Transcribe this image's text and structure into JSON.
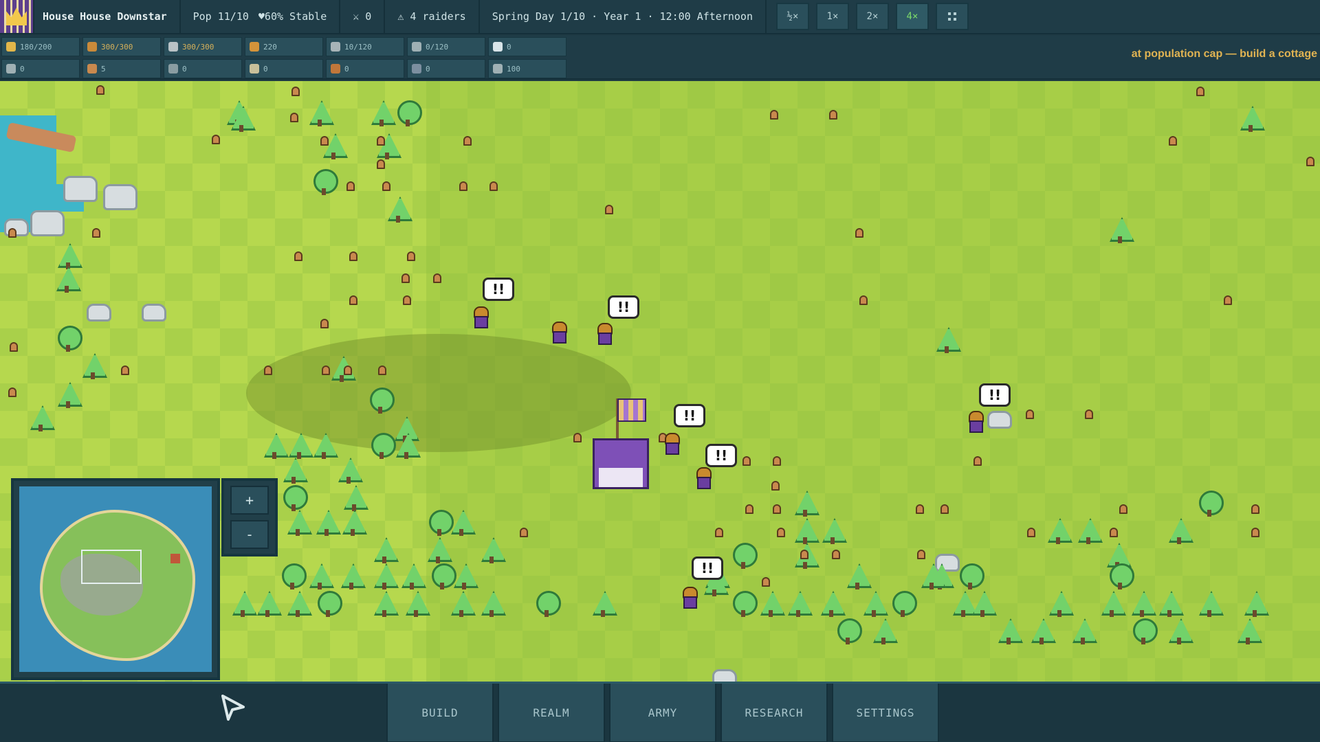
{
  "topbar": {
    "house_name": "House House Downstar",
    "population": "Pop 11/10",
    "stability": "♥60% Stable",
    "soldiers": "⚔ 0",
    "raiders": "⚠ 4 raiders",
    "date": "Spring Day 1/10 · Year 1 · 12:00 Afternoon",
    "speeds": [
      "½×",
      "1×",
      "2×",
      "4×"
    ],
    "active_speed": "4×",
    "pause_icon": "pause-icon"
  },
  "resources": {
    "row1": [
      {
        "icon": "gold-icon",
        "color": "#e2b64a",
        "value": "180/200"
      },
      {
        "icon": "food-icon",
        "color": "#c98a3a",
        "value": "300/300",
        "warn": true
      },
      {
        "icon": "stone-icon",
        "color": "#b8c2c6",
        "value": "300/300",
        "warn": true
      },
      {
        "icon": "coin-icon",
        "color": "#d4943a",
        "value": "220"
      },
      {
        "icon": "iron-icon",
        "color": "#a8b4b8",
        "value": "10/120"
      },
      {
        "icon": "tools-icon",
        "color": "#9fb0b4",
        "value": "0/120"
      },
      {
        "icon": "water-icon",
        "color": "#d8e4e8",
        "value": "0"
      }
    ],
    "row2": [
      {
        "icon": "sword-icon",
        "color": "#9fb0b4",
        "value": "0"
      },
      {
        "icon": "worker-icon",
        "color": "#c9894e",
        "value": "5"
      },
      {
        "icon": "bottle-icon",
        "color": "#8a9da2",
        "value": "0"
      },
      {
        "icon": "lantern-icon",
        "color": "#c9c09a",
        "value": "0"
      },
      {
        "icon": "gear-icon",
        "color": "#c0773a",
        "value": "0"
      },
      {
        "icon": "shield-icon",
        "color": "#7c8fa0",
        "value": "0"
      },
      {
        "icon": "arrow-icon",
        "color": "#9fb0b4",
        "value": "100"
      }
    ]
  },
  "alert": "at population cap — build a cottage",
  "map": {
    "bubbles": [
      "!!",
      "!!",
      "!!",
      "!!",
      "!!",
      "!!"
    ]
  },
  "minimap": {
    "zoom_in": "+",
    "zoom_out": "-"
  },
  "menu": [
    "BUILD",
    "REALM",
    "ARMY",
    "RESEARCH",
    "SETTINGS"
  ]
}
